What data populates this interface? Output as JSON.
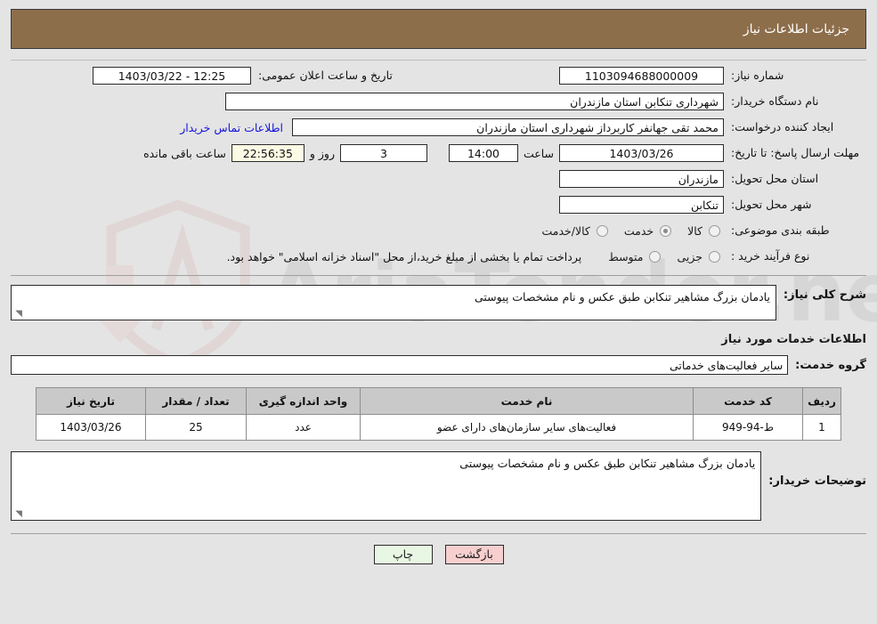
{
  "header": {
    "title": "جزئیات اطلاعات نیاز"
  },
  "form": {
    "need_number_label": "شماره نیاز:",
    "need_number": "1103094688000009",
    "announce_label": "تاریخ و ساعت اعلان عمومی:",
    "announce_value": "12:25 - 1403/03/22",
    "buyer_org_label": "نام دستگاه خریدار:",
    "buyer_org": "شهرداری تنکابن استان مازندران",
    "creator_label": "ایجاد کننده درخواست:",
    "creator": "محمد تقی جهانفر کاربرداز شهرداری استان مازندران",
    "contact_link": "اطلاعات تماس خریدار",
    "deadline_label": "مهلت ارسال پاسخ: تا تاریخ:",
    "deadline_date": "1403/03/26",
    "hour_label": "ساعت",
    "deadline_time": "14:00",
    "days_remaining": "3",
    "days_label": "روز و",
    "countdown": "22:56:35",
    "remaining_label": "ساعت باقی مانده",
    "province_label": "استان محل تحویل:",
    "province": "مازندران",
    "city_label": "شهر محل تحویل:",
    "city": "تنکابن",
    "category_label": "طبقه بندی موضوعی:",
    "category_options": [
      {
        "label": "کالا",
        "selected": false
      },
      {
        "label": "خدمت",
        "selected": true
      },
      {
        "label": "کالا/خدمت",
        "selected": false
      }
    ],
    "process_label": "نوع فرآیند خرید :",
    "process_options": [
      {
        "label": "جزیی",
        "selected": false
      },
      {
        "label": "متوسط",
        "selected": false
      }
    ],
    "payment_note": "پرداخت تمام یا بخشی از مبلغ خرید،از محل \"اسناد خزانه اسلامی\" خواهد بود."
  },
  "description": {
    "label": "شرح کلی نیاز:",
    "value": "یادمان بزرگ مشاهیر تنکابن طبق عکس و نام مشخصات پیوستی"
  },
  "services": {
    "section_title": "اطلاعات خدمات مورد نیاز",
    "group_label": "گروه خدمت:",
    "group_value": "سایر فعالیت‌های خدماتی",
    "table": {
      "columns": [
        "ردیف",
        "کد خدمت",
        "نام خدمت",
        "واحد اندازه گیری",
        "تعداد / مقدار",
        "تاریخ نیاز"
      ],
      "rows": [
        [
          "1",
          "ط-94-949",
          "فعالیت‌های سایر سازمان‌های دارای عضو",
          "عدد",
          "25",
          "1403/03/26"
        ]
      ]
    }
  },
  "buyer_notes": {
    "label": "توضیحات خریدار:",
    "value": "یادمان بزرگ مشاهیر تنکابن طبق عکس و نام مشخصات پیوستی"
  },
  "footer": {
    "back_label": "بازگشت",
    "print_label": "چاپ"
  },
  "watermark": {
    "text": "AriaTender.net"
  }
}
